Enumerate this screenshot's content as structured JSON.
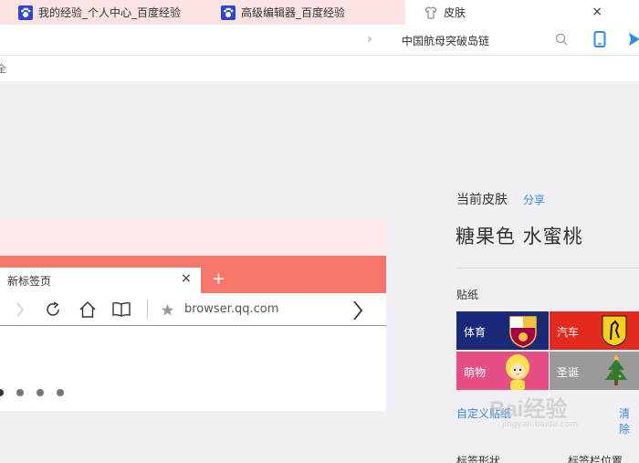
{
  "tabs": [
    {
      "title": "我的经验_个人中心_百度经验",
      "icon": "baidu-paw-icon"
    },
    {
      "title": "高级编辑器_百度经验",
      "icon": "baidu-paw-icon"
    },
    {
      "title": "皮肤",
      "icon": "shirt-icon",
      "active": true
    }
  ],
  "tab_close": "×",
  "addressbar": {
    "chevron": "›",
    "search_text": "中国航母突破岛链",
    "search_icon": "search-icon",
    "phone_icon": "phone-icon",
    "send_icon": "send-icon"
  },
  "substrip": {
    "text": "全"
  },
  "preview": {
    "tab_label": "新标签页",
    "tab_close": "×",
    "new_tab": "+",
    "url": "browser.qq.com",
    "dots": 4
  },
  "panel": {
    "current_skin_label": "当前皮肤",
    "share": "分享",
    "skin_name": "糖果色 水蜜桃",
    "stickers_label": "贴纸",
    "stickers": [
      "体育",
      "汽车",
      "萌物",
      "圣诞"
    ],
    "custom_sticker": "自定义贴纸",
    "clear": "清除",
    "tab_shape": "标签形状",
    "tab_position": "标签栏位置"
  },
  "watermark": {
    "text": "Bai经验",
    "subtext": "jingyan.baidu.com"
  },
  "colors": {
    "tabstrip": "#fbe3e3",
    "accent": "#f6766a",
    "link": "#3b8ad8"
  }
}
